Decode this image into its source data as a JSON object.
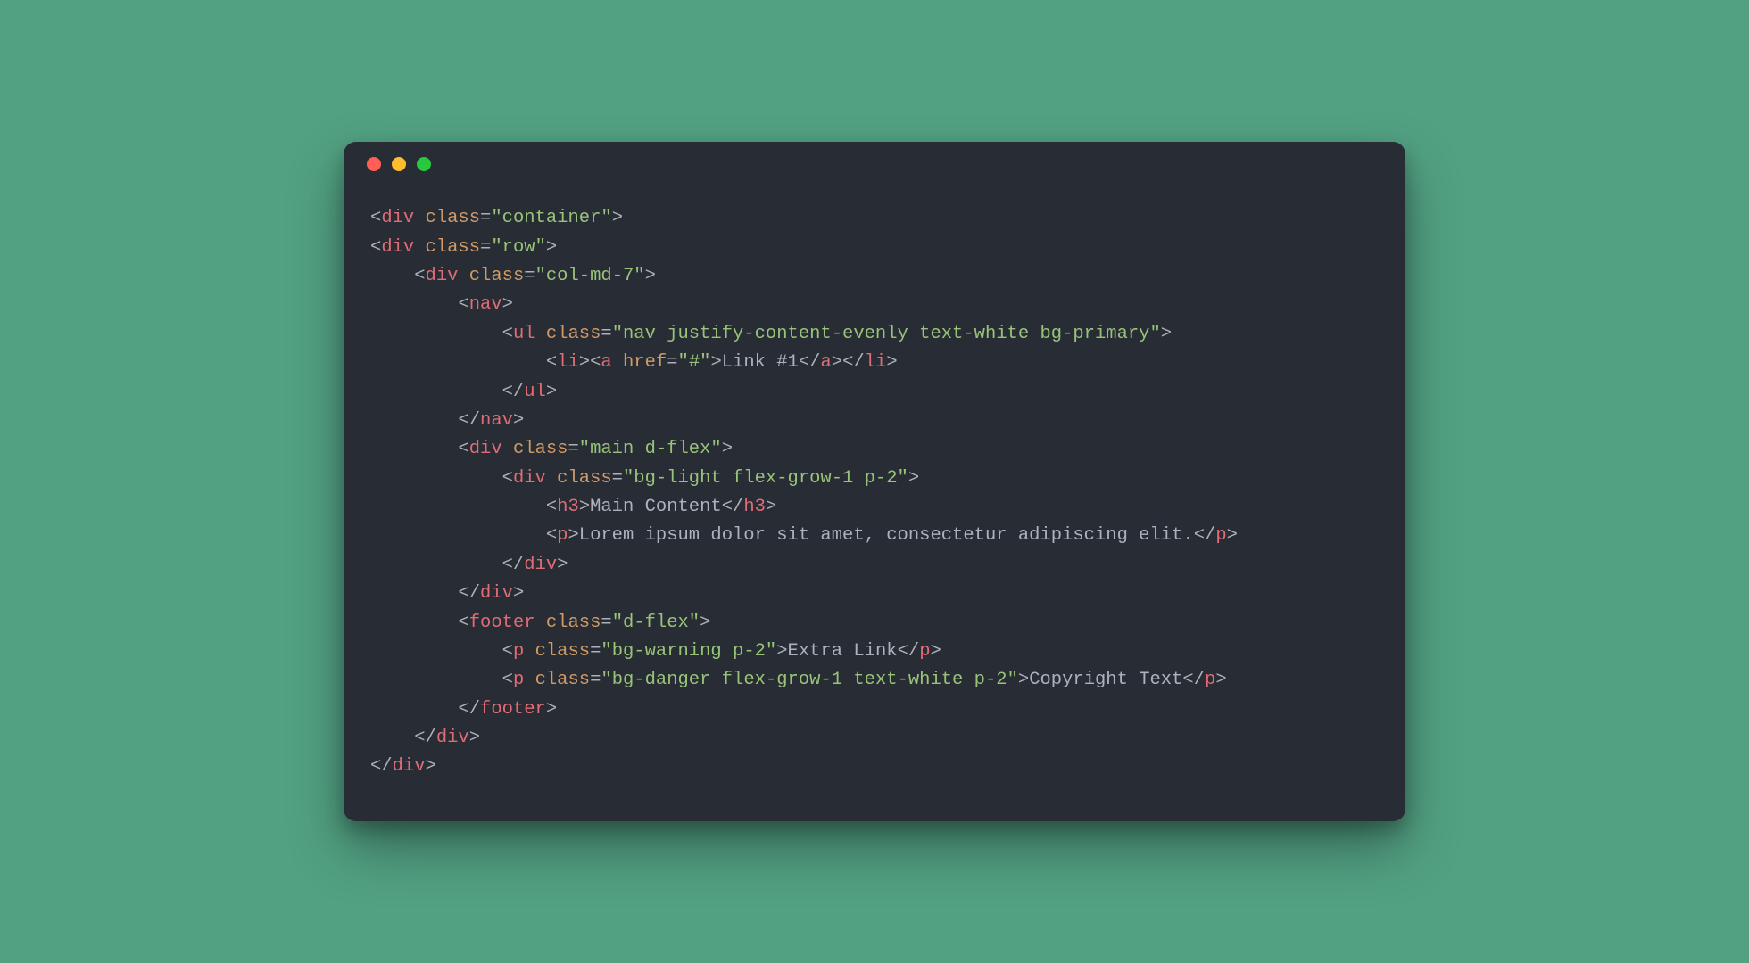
{
  "code": {
    "lines": [
      {
        "indent": 0,
        "parts": [
          {
            "c": "p",
            "t": "<"
          },
          {
            "c": "tag",
            "t": "div"
          },
          {
            "c": "p",
            "t": " "
          },
          {
            "c": "att",
            "t": "class"
          },
          {
            "c": "eq",
            "t": "="
          },
          {
            "c": "str",
            "t": "\"container\""
          },
          {
            "c": "p",
            "t": ">"
          }
        ]
      },
      {
        "indent": 0,
        "parts": [
          {
            "c": "p",
            "t": "<"
          },
          {
            "c": "tag",
            "t": "div"
          },
          {
            "c": "p",
            "t": " "
          },
          {
            "c": "att",
            "t": "class"
          },
          {
            "c": "eq",
            "t": "="
          },
          {
            "c": "str",
            "t": "\"row\""
          },
          {
            "c": "p",
            "t": ">"
          }
        ]
      },
      {
        "indent": 4,
        "parts": [
          {
            "c": "p",
            "t": "<"
          },
          {
            "c": "tag",
            "t": "div"
          },
          {
            "c": "p",
            "t": " "
          },
          {
            "c": "att",
            "t": "class"
          },
          {
            "c": "eq",
            "t": "="
          },
          {
            "c": "str",
            "t": "\"col-md-7\""
          },
          {
            "c": "p",
            "t": ">"
          }
        ]
      },
      {
        "indent": 8,
        "parts": [
          {
            "c": "p",
            "t": "<"
          },
          {
            "c": "tag",
            "t": "nav"
          },
          {
            "c": "p",
            "t": ">"
          }
        ]
      },
      {
        "indent": 12,
        "parts": [
          {
            "c": "p",
            "t": "<"
          },
          {
            "c": "tag",
            "t": "ul"
          },
          {
            "c": "p",
            "t": " "
          },
          {
            "c": "att",
            "t": "class"
          },
          {
            "c": "eq",
            "t": "="
          },
          {
            "c": "str",
            "t": "\"nav justify-content-evenly text-white bg-primary\""
          },
          {
            "c": "p",
            "t": ">"
          }
        ]
      },
      {
        "indent": 16,
        "parts": [
          {
            "c": "p",
            "t": "<"
          },
          {
            "c": "tag",
            "t": "li"
          },
          {
            "c": "p",
            "t": "><"
          },
          {
            "c": "tag",
            "t": "a"
          },
          {
            "c": "p",
            "t": " "
          },
          {
            "c": "att",
            "t": "href"
          },
          {
            "c": "eq",
            "t": "="
          },
          {
            "c": "str",
            "t": "\"#\""
          },
          {
            "c": "p",
            "t": ">"
          },
          {
            "c": "txt",
            "t": "Link #1"
          },
          {
            "c": "p",
            "t": "</"
          },
          {
            "c": "tag",
            "t": "a"
          },
          {
            "c": "p",
            "t": "></"
          },
          {
            "c": "tag",
            "t": "li"
          },
          {
            "c": "p",
            "t": ">"
          }
        ]
      },
      {
        "indent": 12,
        "parts": [
          {
            "c": "p",
            "t": "</"
          },
          {
            "c": "tag",
            "t": "ul"
          },
          {
            "c": "p",
            "t": ">"
          }
        ]
      },
      {
        "indent": 8,
        "parts": [
          {
            "c": "p",
            "t": "</"
          },
          {
            "c": "tag",
            "t": "nav"
          },
          {
            "c": "p",
            "t": ">"
          }
        ]
      },
      {
        "indent": 8,
        "parts": [
          {
            "c": "p",
            "t": "<"
          },
          {
            "c": "tag",
            "t": "div"
          },
          {
            "c": "p",
            "t": " "
          },
          {
            "c": "att",
            "t": "class"
          },
          {
            "c": "eq",
            "t": "="
          },
          {
            "c": "str",
            "t": "\"main d-flex\""
          },
          {
            "c": "p",
            "t": ">"
          }
        ]
      },
      {
        "indent": 12,
        "parts": [
          {
            "c": "p",
            "t": "<"
          },
          {
            "c": "tag",
            "t": "div"
          },
          {
            "c": "p",
            "t": " "
          },
          {
            "c": "att",
            "t": "class"
          },
          {
            "c": "eq",
            "t": "="
          },
          {
            "c": "str",
            "t": "\"bg-light flex-grow-1 p-2\""
          },
          {
            "c": "p",
            "t": ">"
          }
        ]
      },
      {
        "indent": 16,
        "parts": [
          {
            "c": "p",
            "t": "<"
          },
          {
            "c": "tag",
            "t": "h3"
          },
          {
            "c": "p",
            "t": ">"
          },
          {
            "c": "txt",
            "t": "Main Content"
          },
          {
            "c": "p",
            "t": "</"
          },
          {
            "c": "tag",
            "t": "h3"
          },
          {
            "c": "p",
            "t": ">"
          }
        ]
      },
      {
        "indent": 16,
        "parts": [
          {
            "c": "p",
            "t": "<"
          },
          {
            "c": "tag",
            "t": "p"
          },
          {
            "c": "p",
            "t": ">"
          },
          {
            "c": "txt",
            "t": "Lorem ipsum dolor sit amet, consectetur adipiscing elit."
          },
          {
            "c": "p",
            "t": "</"
          },
          {
            "c": "tag",
            "t": "p"
          },
          {
            "c": "p",
            "t": ">"
          }
        ]
      },
      {
        "indent": 12,
        "parts": [
          {
            "c": "p",
            "t": "</"
          },
          {
            "c": "tag",
            "t": "div"
          },
          {
            "c": "p",
            "t": ">"
          }
        ]
      },
      {
        "indent": 8,
        "parts": [
          {
            "c": "p",
            "t": "</"
          },
          {
            "c": "tag",
            "t": "div"
          },
          {
            "c": "p",
            "t": ">"
          }
        ]
      },
      {
        "indent": 8,
        "parts": [
          {
            "c": "p",
            "t": "<"
          },
          {
            "c": "tag",
            "t": "footer"
          },
          {
            "c": "p",
            "t": " "
          },
          {
            "c": "att",
            "t": "class"
          },
          {
            "c": "eq",
            "t": "="
          },
          {
            "c": "str",
            "t": "\"d-flex\""
          },
          {
            "c": "p",
            "t": ">"
          }
        ]
      },
      {
        "indent": 12,
        "parts": [
          {
            "c": "p",
            "t": "<"
          },
          {
            "c": "tag",
            "t": "p"
          },
          {
            "c": "p",
            "t": " "
          },
          {
            "c": "att",
            "t": "class"
          },
          {
            "c": "eq",
            "t": "="
          },
          {
            "c": "str",
            "t": "\"bg-warning p-2\""
          },
          {
            "c": "p",
            "t": ">"
          },
          {
            "c": "txt",
            "t": "Extra Link"
          },
          {
            "c": "p",
            "t": "</"
          },
          {
            "c": "tag",
            "t": "p"
          },
          {
            "c": "p",
            "t": ">"
          }
        ]
      },
      {
        "indent": 12,
        "parts": [
          {
            "c": "p",
            "t": "<"
          },
          {
            "c": "tag",
            "t": "p"
          },
          {
            "c": "p",
            "t": " "
          },
          {
            "c": "att",
            "t": "class"
          },
          {
            "c": "eq",
            "t": "="
          },
          {
            "c": "str",
            "t": "\"bg-danger flex-grow-1 text-white p-2\""
          },
          {
            "c": "p",
            "t": ">"
          },
          {
            "c": "txt",
            "t": "Copyright Text"
          },
          {
            "c": "p",
            "t": "</"
          },
          {
            "c": "tag",
            "t": "p"
          },
          {
            "c": "p",
            "t": ">"
          }
        ]
      },
      {
        "indent": 8,
        "parts": [
          {
            "c": "p",
            "t": "</"
          },
          {
            "c": "tag",
            "t": "footer"
          },
          {
            "c": "p",
            "t": ">"
          }
        ]
      },
      {
        "indent": 4,
        "parts": [
          {
            "c": "p",
            "t": "</"
          },
          {
            "c": "tag",
            "t": "div"
          },
          {
            "c": "p",
            "t": ">"
          }
        ]
      },
      {
        "indent": 0,
        "parts": [
          {
            "c": "p",
            "t": "</"
          },
          {
            "c": "tag",
            "t": "div"
          },
          {
            "c": "p",
            "t": ">"
          }
        ]
      }
    ]
  }
}
